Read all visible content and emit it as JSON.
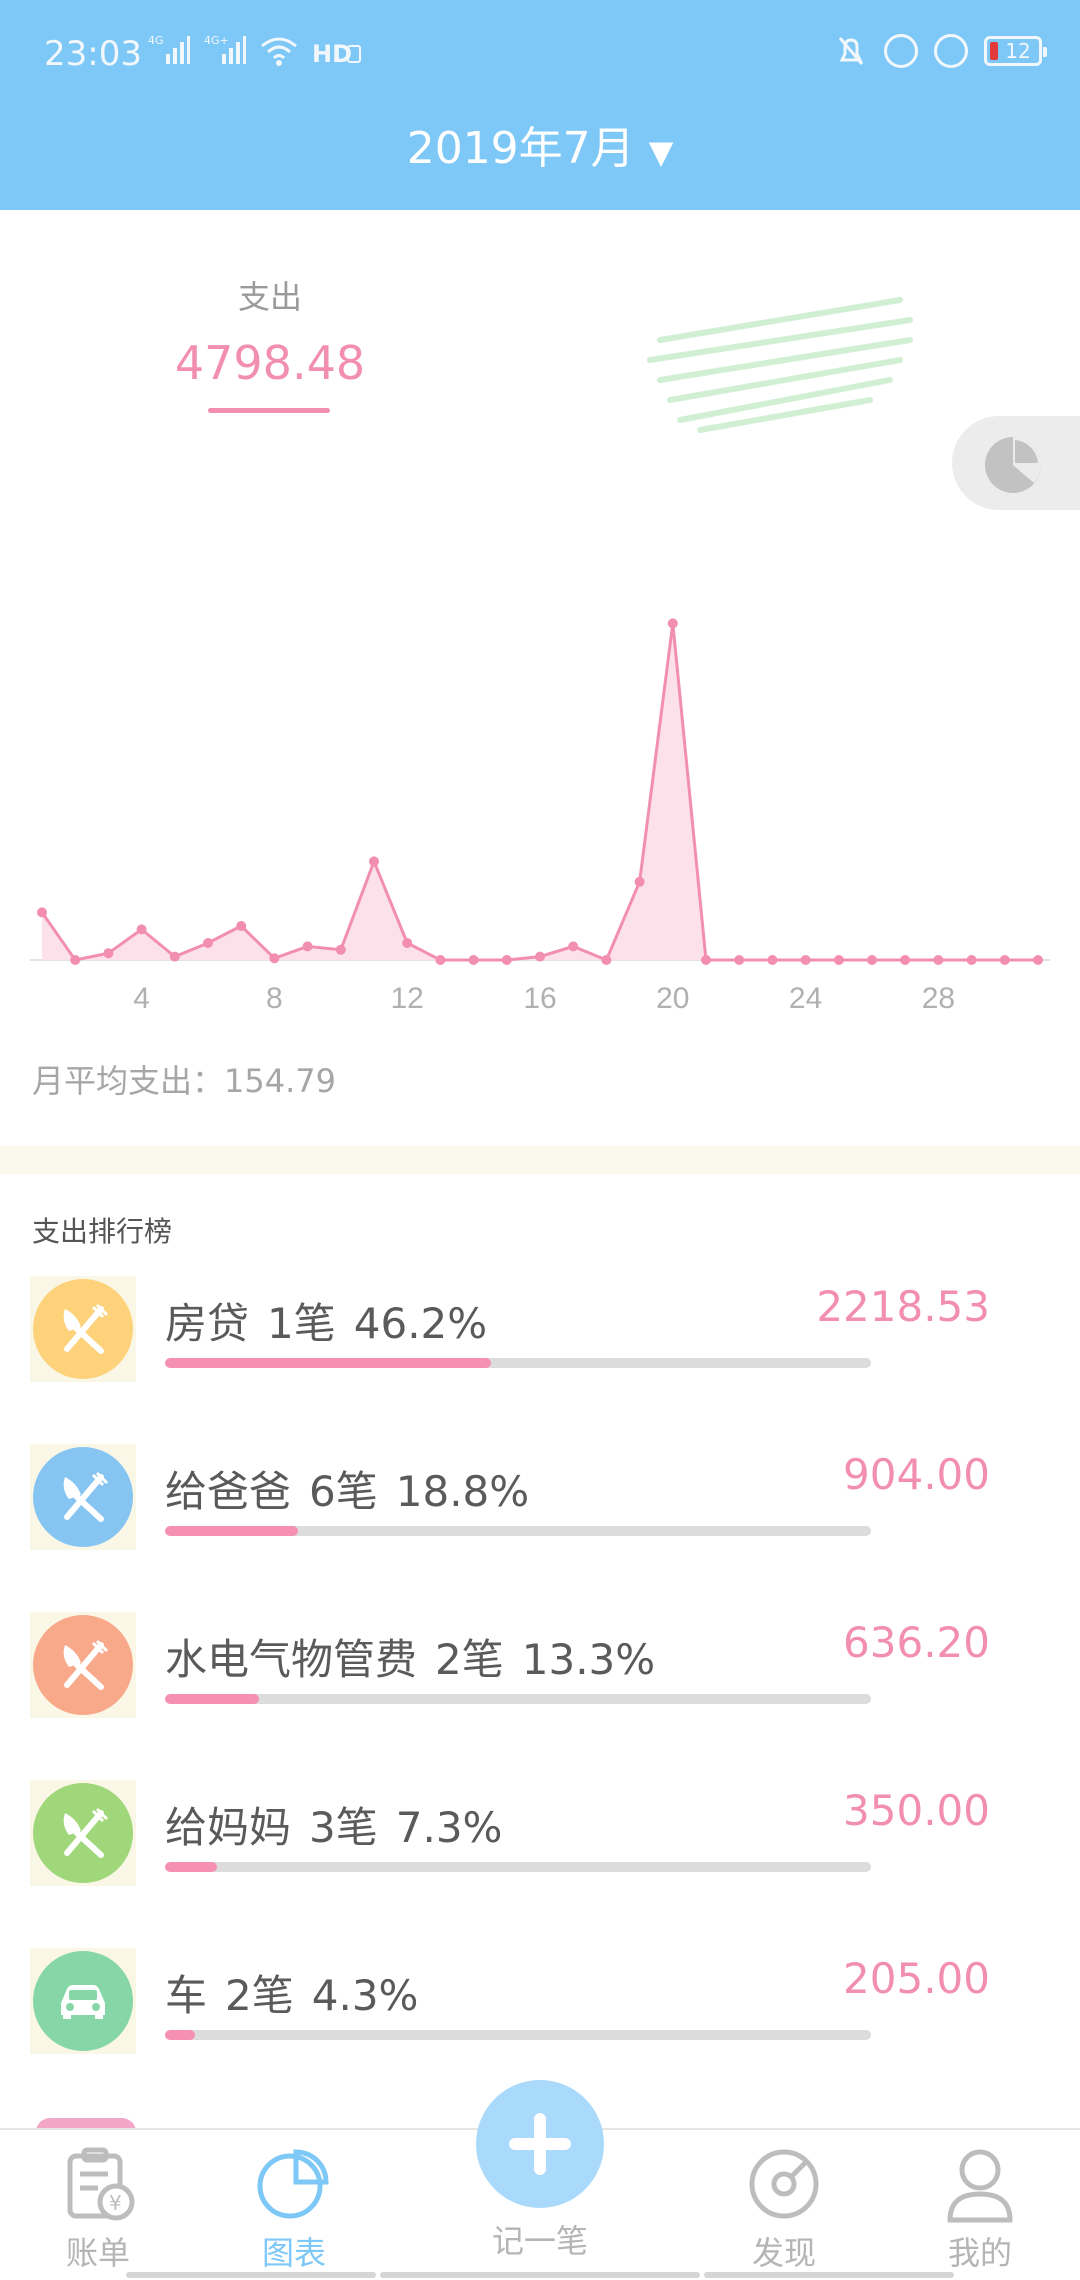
{
  "status_bar": {
    "time": "23:03",
    "signal1": "4G",
    "signal2": "4G+",
    "hd": "HD",
    "battery": "12"
  },
  "header": {
    "month": "2019年7月",
    "dropdown_glyph": "▼"
  },
  "summary": {
    "label": "支出",
    "amount": "4798.48"
  },
  "chart_data": {
    "type": "area",
    "x": [
      1,
      2,
      3,
      4,
      5,
      6,
      7,
      8,
      9,
      10,
      11,
      12,
      13,
      14,
      15,
      16,
      17,
      18,
      19,
      20,
      21,
      22,
      23,
      24,
      25,
      26,
      27,
      28,
      29,
      30,
      31
    ],
    "values": [
      140,
      0,
      20,
      90,
      10,
      50,
      100,
      5,
      40,
      30,
      290,
      50,
      0,
      0,
      0,
      10,
      40,
      0,
      230,
      990,
      0,
      0,
      0,
      0,
      0,
      0,
      0,
      0,
      0,
      0,
      0
    ],
    "xticks": [
      "4",
      "8",
      "12",
      "16",
      "20",
      "24",
      "28"
    ],
    "ylim": [
      0,
      1000
    ],
    "color": "#f28fb0",
    "fill": "#fce1ea"
  },
  "average": {
    "text": "月平均支出：154.79"
  },
  "ranking": {
    "title": "支出排行榜",
    "items": [
      {
        "category": "房贷",
        "count": "1笔",
        "percent": "46.2%",
        "amount": "2218.53",
        "ratio": 0.462,
        "icon_color": "#fdd27a",
        "icon": "utensils-icon"
      },
      {
        "category": "给爸爸",
        "count": "6笔",
        "percent": "18.8%",
        "amount": "904.00",
        "ratio": 0.188,
        "icon_color": "#86c5f2",
        "icon": "utensils-icon"
      },
      {
        "category": "水电气物管费",
        "count": "2笔",
        "percent": "13.3%",
        "amount": "636.20",
        "ratio": 0.133,
        "icon_color": "#f7a98a",
        "icon": "utensils-icon"
      },
      {
        "category": "给妈妈",
        "count": "3笔",
        "percent": "7.3%",
        "amount": "350.00",
        "ratio": 0.073,
        "icon_color": "#9fd77a",
        "icon": "utensils-icon"
      },
      {
        "category": "车",
        "count": "2笔",
        "percent": "4.3%",
        "amount": "205.00",
        "ratio": 0.043,
        "icon_color": "#86d6a8",
        "icon": "car-icon"
      }
    ]
  },
  "nav": {
    "bills": "账单",
    "charts": "图表",
    "add": "记一笔",
    "discover": "发现",
    "mine": "我的",
    "active": "charts",
    "active_color": "#7ec8f7"
  }
}
